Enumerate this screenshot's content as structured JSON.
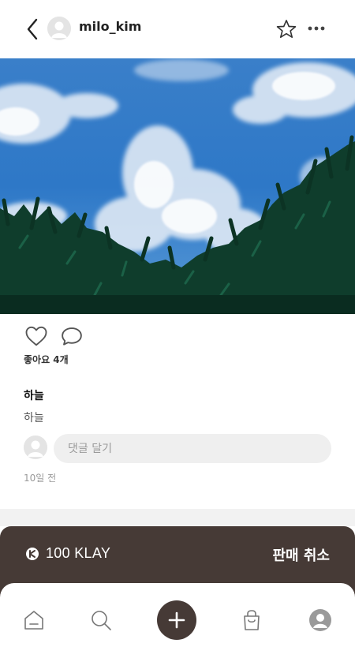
{
  "header": {
    "username": "milo_kim",
    "icons": [
      "back-arrow-icon",
      "avatar-icon",
      "star-icon",
      "more-icon"
    ]
  },
  "post": {
    "likes_label": "좋아요 4개",
    "title": "하늘",
    "description": "하늘",
    "comment_placeholder": "댓글 달기",
    "time": "10일 전"
  },
  "sale": {
    "price": "100 KLAY",
    "cancel_label": "판매 취소"
  },
  "nav": {
    "items": [
      "home-icon",
      "search-icon",
      "add-icon",
      "shop-icon",
      "profile-icon"
    ]
  },
  "colors": {
    "brand_dark": "#463a36",
    "divider": "#f2f2f2",
    "input_bg": "#efefef",
    "sky": "#2e78c7",
    "foliage": "#0f3d2c"
  }
}
